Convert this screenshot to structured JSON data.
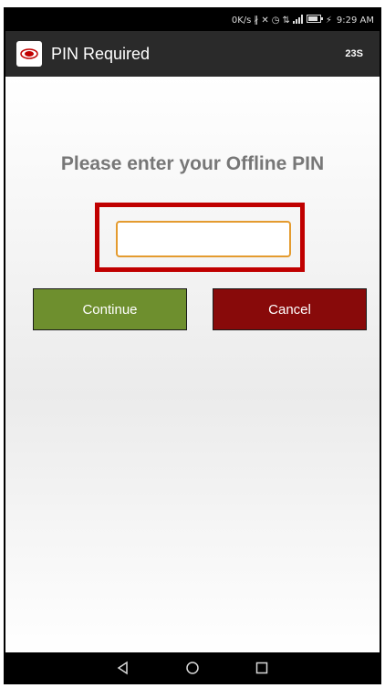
{
  "status_bar": {
    "speed": "0K/s",
    "time": "9:29 AM",
    "icons": [
      "bluetooth-icon",
      "mute-icon",
      "alarm-icon",
      "data-icon",
      "signal-icon",
      "battery-icon",
      "charging-icon"
    ]
  },
  "app_bar": {
    "title": "PIN Required",
    "timer": "23S",
    "logo": "card-logo-icon"
  },
  "main": {
    "prompt": "Please enter your Offline PIN",
    "pin_input": {
      "value": "",
      "placeholder": ""
    },
    "continue_label": "Continue",
    "cancel_label": "Cancel"
  },
  "nav_bar": {
    "icons": [
      "back-icon",
      "home-icon",
      "recents-icon"
    ]
  },
  "colors": {
    "continue": "#6e8f2e",
    "cancel": "#880a0a",
    "highlight": "#c00000",
    "input_border": "#e49b2f",
    "app_bar": "#2a2a2a"
  }
}
